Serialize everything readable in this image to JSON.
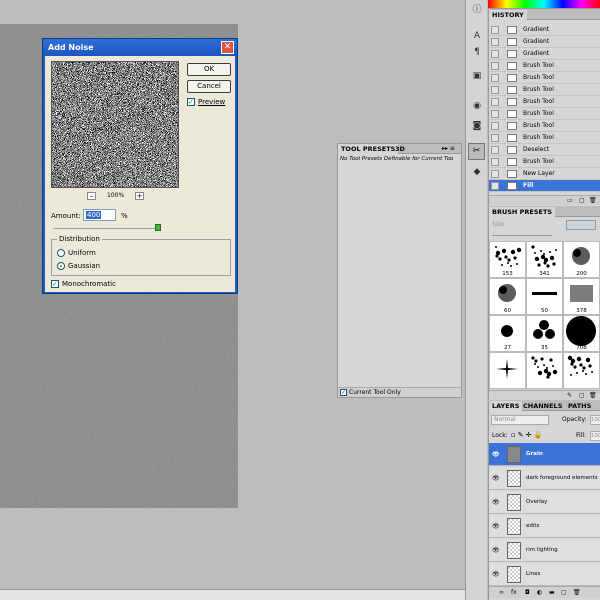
{
  "dialog": {
    "title": "Add Noise",
    "ok": "OK",
    "cancel": "Cancel",
    "preview": "Preview",
    "zoom": "100%",
    "amount_label": "Amount:",
    "amount_value": "400",
    "amount_unit": "%",
    "distribution_label": "Distribution",
    "uniform": "Uniform",
    "gaussian": "Gaussian",
    "monochromatic": "Monochromatic"
  },
  "history": {
    "title": "HISTORY",
    "items": [
      "Gradient",
      "Gradient",
      "Gradient",
      "Brush Tool",
      "Brush Tool",
      "Brush Tool",
      "Brush Tool",
      "Brush Tool",
      "Brush Tool",
      "Brush Tool",
      "Deselect",
      "Brush Tool",
      "New Layer",
      "Fill"
    ],
    "selected": "Fill"
  },
  "tool_presets": {
    "tab1": "TOOL PRESETS",
    "tab2": "3D",
    "empty_text": "No Tool Presets Definable for Current Too",
    "footer": "Current Tool Only"
  },
  "brush_presets": {
    "title": "BRUSH PRESETS",
    "size_label": "Size:",
    "sizes": [
      "153",
      "341",
      "200",
      "60",
      "50",
      "378",
      "27",
      "35",
      "708",
      "",
      "",
      ""
    ]
  },
  "layers": {
    "tabs": [
      "LAYERS",
      "CHANNELS",
      "PATHS"
    ],
    "blend_mode": "Normal",
    "opacity_label": "Opacity:",
    "opacity_value": "100",
    "lock_label": "Lock:",
    "fill_label": "Fill:",
    "fill_value": "100",
    "items": [
      "Grain",
      "dark foreground elements",
      "Overlay",
      "edits",
      "rim lighting",
      "Lines"
    ],
    "selected": "Grain"
  }
}
